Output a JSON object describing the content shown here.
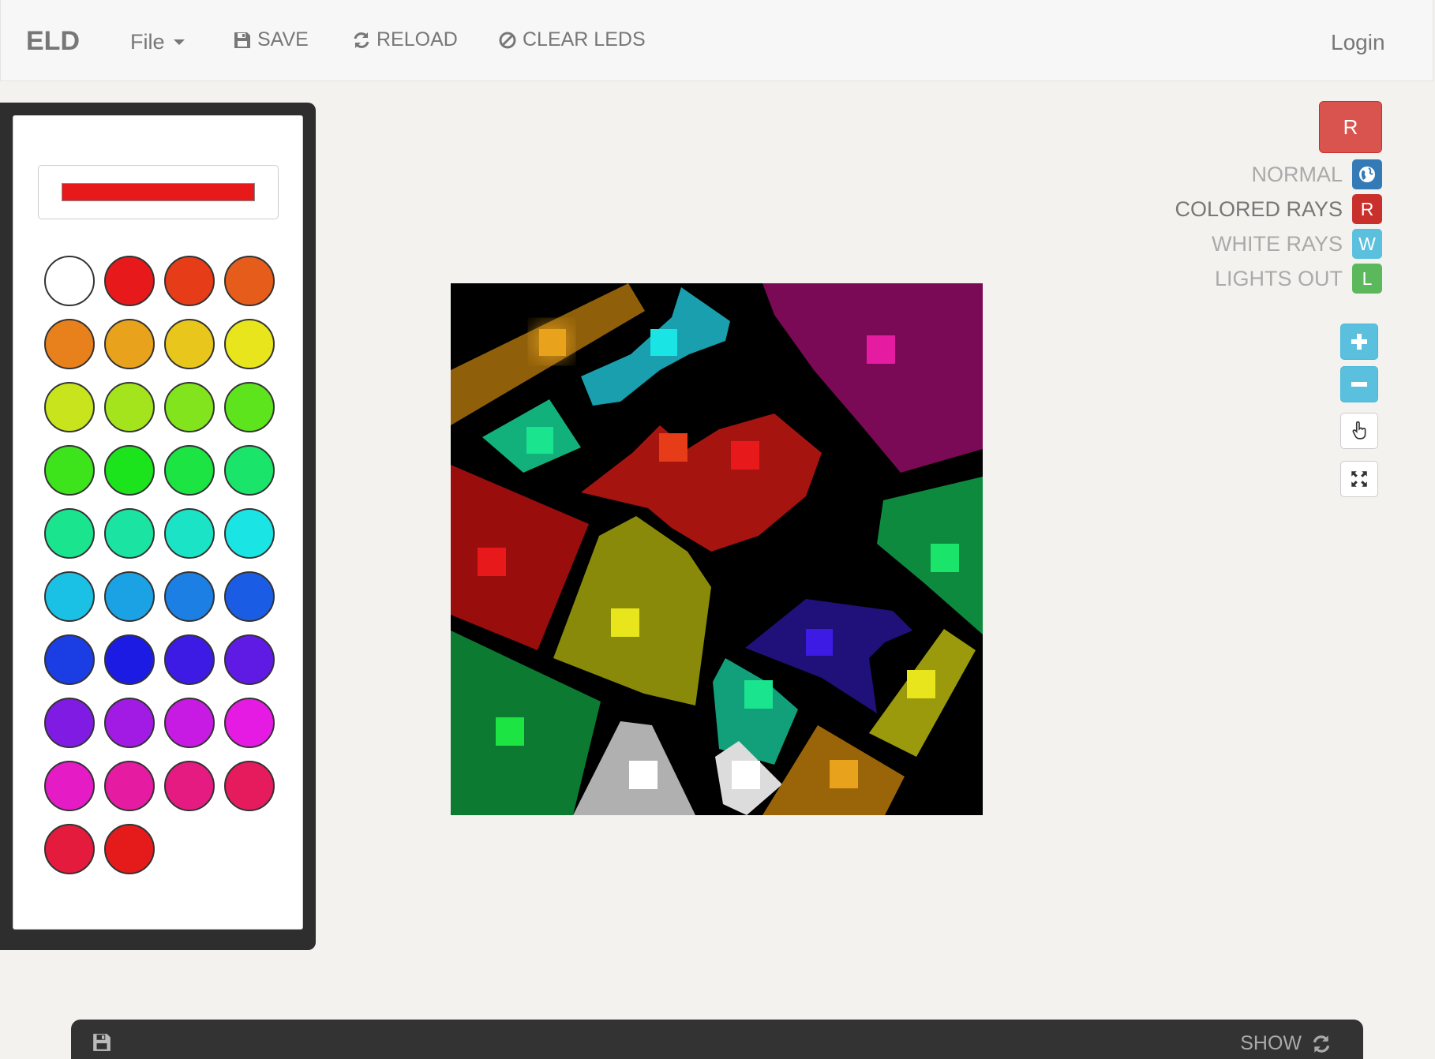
{
  "navbar": {
    "brand": "ELD",
    "file_label": "File",
    "save_label": "SAVE",
    "reload_label": "RELOAD",
    "clear_label": "CLEAR LEDS",
    "login_label": "Login"
  },
  "palette": {
    "selected_color": "#e8191b",
    "swatches": [
      "#ffffff",
      "#e8191b",
      "#e63c18",
      "#e65c1b",
      "#e8811b",
      "#e8a21b",
      "#e9c61c",
      "#e8e51c",
      "#c7e41c",
      "#a4e41c",
      "#82e41c",
      "#5de41c",
      "#3de41c",
      "#1be41c",
      "#1be443",
      "#1be46b",
      "#1be48f",
      "#1be4a2",
      "#1be4c6",
      "#1be4e4",
      "#1bc1e4",
      "#1ba2e4",
      "#1b7fe4",
      "#1b5ce4",
      "#1b3de4",
      "#1b1be4",
      "#3d1be4",
      "#5f1be4",
      "#801be4",
      "#a21be4",
      "#c71be4",
      "#e51be4",
      "#e51bc6",
      "#e51ba2",
      "#e51b82",
      "#e51b5e",
      "#e51b3d",
      "#e51b1b"
    ]
  },
  "modes": {
    "current_badge": "R",
    "items": [
      {
        "label": "NORMAL",
        "badge": "",
        "color": "#337ab7",
        "icon": "globe-icon",
        "active": false
      },
      {
        "label": "COLORED RAYS",
        "badge": "R",
        "color": "#d9534f",
        "active": true
      },
      {
        "label": "WHITE RAYS",
        "badge": "W",
        "color": "#5bc0de",
        "active": false
      },
      {
        "label": "LIGHTS OUT",
        "badge": "L",
        "color": "#5cb85c",
        "active": false
      }
    ]
  },
  "tools": {
    "zoom_in": "+",
    "zoom_out": "−"
  },
  "bottom_bar": {
    "show_label": "SHOW"
  }
}
